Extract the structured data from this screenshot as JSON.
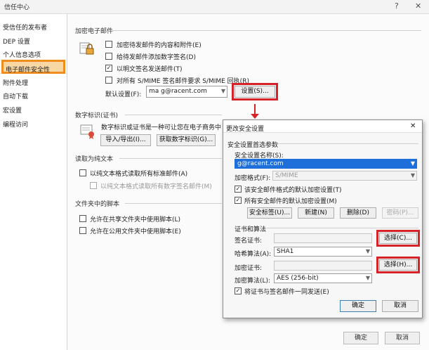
{
  "window": {
    "title": "信任中心",
    "help_glyph": "?",
    "close_glyph": "✕"
  },
  "sidebar": {
    "items": [
      {
        "label": "受信任的发布者"
      },
      {
        "label": "DEP 设置"
      },
      {
        "label": "个人信息选项"
      },
      {
        "label": "电子邮件安全性",
        "active": true
      },
      {
        "label": "附件处理"
      },
      {
        "label": "自动下载"
      },
      {
        "label": "宏设置"
      },
      {
        "label": "编程访问"
      }
    ]
  },
  "encrypted": {
    "title": "加密电子邮件",
    "options": [
      {
        "label": "加密待发邮件的内容和附件(E)",
        "checked": false
      },
      {
        "label": "给待发邮件添加数字签名(D)",
        "checked": false
      },
      {
        "label": "以明文签名发送邮件(T)",
        "checked": true
      },
      {
        "label": "对所有 S/MIME 签名邮件要求 S/MIME 回执(R)",
        "checked": false
      }
    ],
    "default_label": "默认设置(F):",
    "default_value": "ma      g@racent.com",
    "settings_button": "设置(S)..."
  },
  "digital_id": {
    "title": "数字标识(证书)",
    "description": "数字标识或证书是一种可让您在电子商务中",
    "import_export_button": "导入/导出(I)...",
    "get_id_button": "获取数字标识(G)..."
  },
  "read_plain": {
    "title": "读取为纯文本",
    "options": [
      {
        "label": "以纯文本格式读取所有标准邮件(A)",
        "checked": false,
        "enabled": true
      },
      {
        "label": "以纯文本格式读取所有数字签名邮件(M)",
        "checked": false,
        "enabled": false
      }
    ]
  },
  "folder_scripts": {
    "title": "文件夹中的脚本",
    "options": [
      {
        "label": "允许在共享文件夹中使用脚本(L)",
        "checked": false
      },
      {
        "label": "允许在公用文件夹中使用脚本(E)",
        "checked": false
      }
    ]
  },
  "footer": {
    "ok_label": "确定",
    "cancel_label": "取消"
  },
  "dialog": {
    "title": "更改安全设置",
    "close_glyph": "✕",
    "prefs_section": "安全设置首选参数",
    "name_label": "安全设置名称(S):",
    "name_value": "         g@racent.com",
    "crypto_format_label": "加密格式(F):",
    "crypto_format_value": "S/MIME",
    "checkbox_default_for_format": "该安全邮件格式的默认加密设置(T)",
    "checkbox_default_for_all": "所有安全邮件的默认加密设置(M)",
    "security_labels_button": "安全标签(U)...",
    "new_button": "新建(N)",
    "delete_button": "删除(D)",
    "password_button": "密码(P)...",
    "cert_section": "证书和算法",
    "signing_cert_label": "签名证书:",
    "signing_cert_value": "",
    "choose_signing_button": "选择(C)...",
    "hash_label": "哈希算法(A):",
    "hash_value": "SHA1",
    "enc_cert_label": "加密证书:",
    "enc_cert_value": "",
    "choose_enc_button": "选择(H)...",
    "enc_algo_label": "加密算法(L):",
    "enc_algo_value": "AES (256-bit)",
    "send_certs_checkbox": "将证书与签名邮件一同发送(E)",
    "ok_button": "确定",
    "cancel_button": "取消"
  },
  "colors": {
    "callout": "#d6232a",
    "sidebar_highlight": "#f08d1f",
    "selected_field": "#1e6fd9"
  }
}
